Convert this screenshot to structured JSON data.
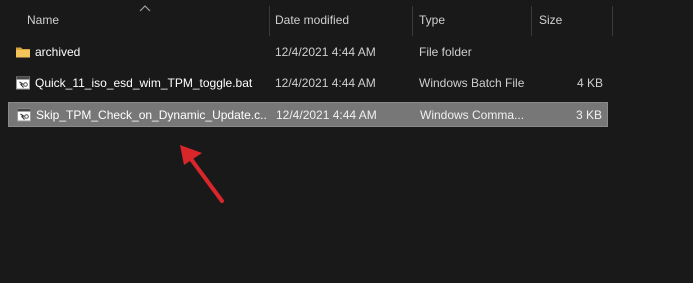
{
  "columns": {
    "name": "Name",
    "date_modified": "Date modified",
    "type": "Type",
    "size": "Size"
  },
  "files": [
    {
      "name": "archived",
      "date_modified": "12/4/2021 4:44 AM",
      "type": "File folder",
      "size": "",
      "icon": "folder-icon",
      "selected": false
    },
    {
      "name": "Quick_11_iso_esd_wim_TPM_toggle.bat",
      "date_modified": "12/4/2021 4:44 AM",
      "type": "Windows Batch File",
      "size": "4 KB",
      "icon": "batch-file-icon",
      "selected": false
    },
    {
      "name": "Skip_TPM_Check_on_Dynamic_Update.c...",
      "date_modified": "12/4/2021 4:44 AM",
      "type": "Windows Comma...",
      "size": "3 KB",
      "icon": "cmd-file-icon",
      "selected": true
    }
  ],
  "colors": {
    "background": "#191919",
    "selected_row": "#777777",
    "arrow": "#d9262a",
    "folder": "#e8b64a"
  }
}
